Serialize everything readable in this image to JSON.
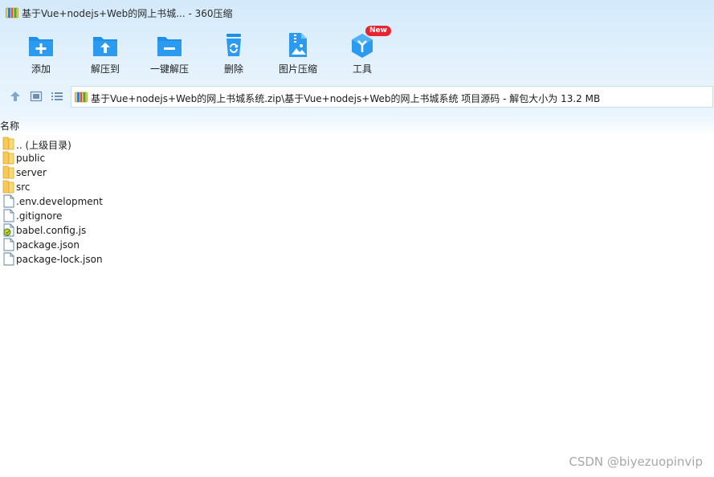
{
  "window": {
    "title": "基于Vue+nodejs+Web的网上书城... - 360压缩",
    "app_icon": "archive-icon"
  },
  "toolbar": {
    "items": [
      {
        "label": "添加",
        "icon": "add-icon"
      },
      {
        "label": "解压到",
        "icon": "extract-to-icon"
      },
      {
        "label": "一键解压",
        "icon": "one-click-extract-icon"
      },
      {
        "label": "删除",
        "icon": "delete-icon"
      },
      {
        "label": "图片压缩",
        "icon": "image-compress-icon"
      },
      {
        "label": "工具",
        "icon": "tools-icon",
        "badge": "New"
      }
    ]
  },
  "nav": {
    "buttons": [
      "up-icon",
      "thumbnail-view-icon",
      "list-view-icon"
    ],
    "address": "基于Vue+nodejs+Web的网上书城系统.zip\\基于Vue+nodejs+Web的网上书城系统 项目源码 - 解包大小为 13.2 MB"
  },
  "file_list": {
    "column_header": "名称",
    "rows": [
      {
        "name": ".. (上级目录)",
        "type": "folder"
      },
      {
        "name": "public",
        "type": "folder"
      },
      {
        "name": "server",
        "type": "folder"
      },
      {
        "name": "src",
        "type": "folder"
      },
      {
        "name": ".env.development",
        "type": "file"
      },
      {
        "name": ".gitignore",
        "type": "file"
      },
      {
        "name": "babel.config.js",
        "type": "js"
      },
      {
        "name": "package.json",
        "type": "file"
      },
      {
        "name": "package-lock.json",
        "type": "file"
      }
    ]
  },
  "watermark": "CSDN @biyezuopinvip",
  "colors": {
    "accent_blue": "#1e8fe3",
    "folder_yellow": "#f5c95a",
    "badge_red": "#e9232f"
  }
}
